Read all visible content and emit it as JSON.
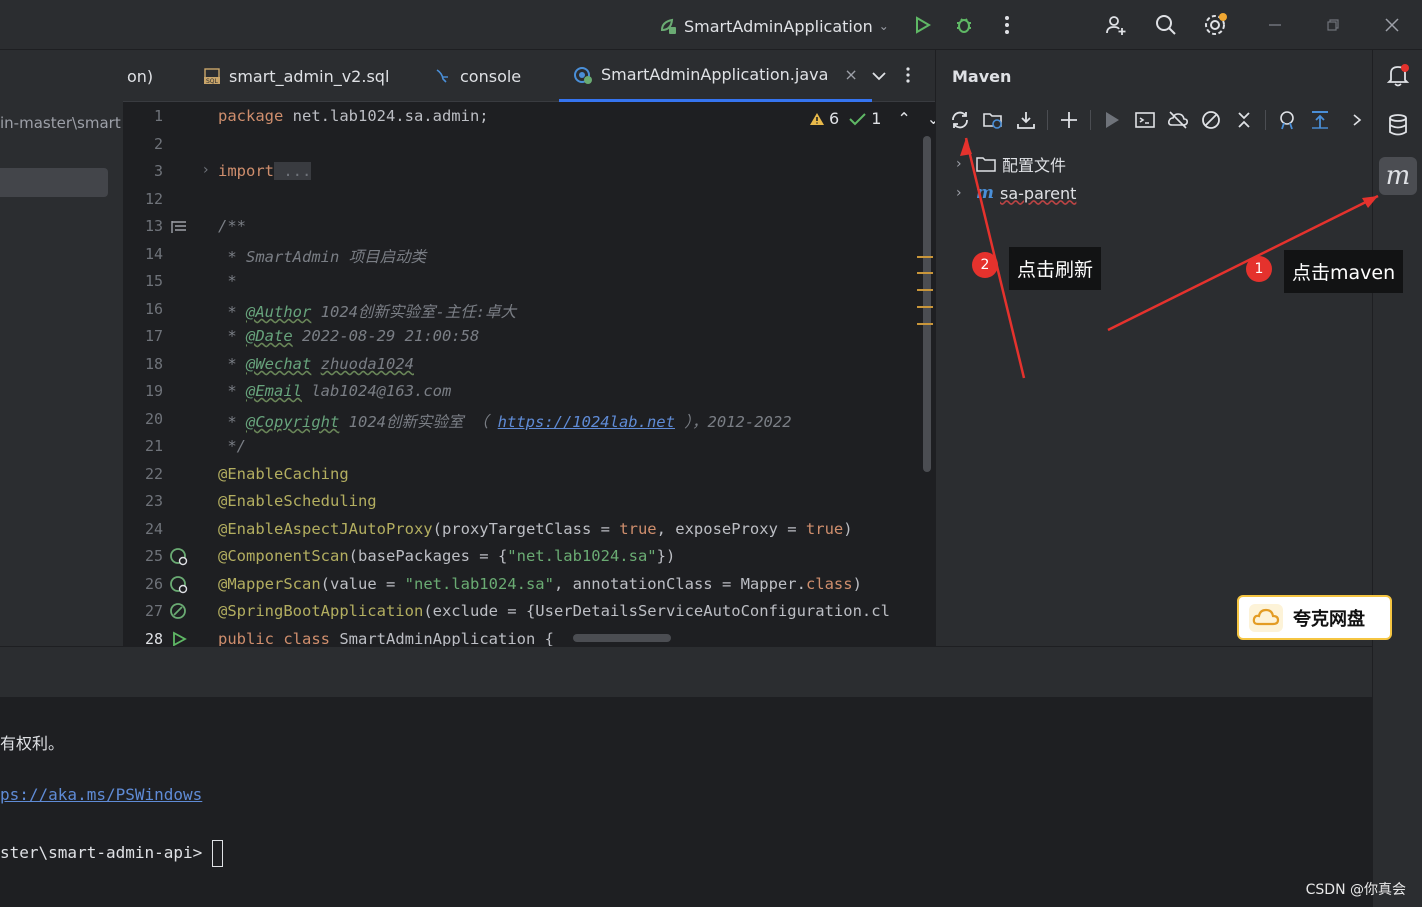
{
  "titlebar": {
    "run_config": "SmartAdminApplication",
    "icons": [
      "run-icon",
      "debug-icon",
      "more-icon",
      "add-user-icon",
      "search-icon",
      "settings-icon",
      "minimize-icon",
      "restore-icon",
      "close-icon"
    ]
  },
  "left_panel": {
    "path_text": "in-master\\smart"
  },
  "tabs": [
    {
      "label": "on)",
      "icon": ""
    },
    {
      "label": "smart_admin_v2.sql",
      "icon": "sql-file-icon"
    },
    {
      "label": "console",
      "icon": "console-icon"
    },
    {
      "label": "SmartAdminApplication.java",
      "icon": "java-class-icon",
      "active": true
    }
  ],
  "editor": {
    "inspection": {
      "warnings": "6",
      "ok": "1"
    },
    "gutter": [
      "1",
      "2",
      "3",
      "12",
      "13",
      "14",
      "15",
      "16",
      "17",
      "18",
      "19",
      "20",
      "21",
      "22",
      "23",
      "24",
      "25",
      "26",
      "27",
      "28"
    ],
    "lines": {
      "l1_kw": "package",
      "l1_rest": " net.lab1024.sa.admin;",
      "l3_kw": "import",
      "l3_fold": " ...",
      "l13": "/**",
      "l14": " * SmartAdmin 项目启动类",
      "l15": " *",
      "l16_tag": "@Author",
      "l16_rest": " 1024创新实验室-主任:卓大",
      "l17_tag": "@Date",
      "l17_rest": " 2022-08-29 21:00:58",
      "l18_tag": "@Wechat",
      "l18_rest": "zhuoda1024",
      "l19_tag": "@Email",
      "l19_rest": " lab1024@163.com",
      "l20_tag": "@Copyright",
      "l20_pre": " 1024创新实验室 （ ",
      "l20_link": "https://1024lab.net",
      "l20_post": " ），2012-2022",
      "l21": " */",
      "l22": "@EnableCaching",
      "l23": "@EnableScheduling",
      "l24_ann": "@EnableAspectJAutoProxy",
      "l24_a": "(proxyTargetClass = ",
      "l24_b": "true",
      "l24_c": ", exposeProxy = ",
      "l24_d": "true",
      "l24_e": ")",
      "l25_ann": "@ComponentScan",
      "l25_a": "(basePackages = {",
      "l25_str": "\"net.lab1024.sa\"",
      "l25_b": "})",
      "l26_ann": "@MapperScan",
      "l26_a": "(value = ",
      "l26_str": "\"net.lab1024.sa\"",
      "l26_b": ", annotationClass = Mapper.",
      "l26_kw": "class",
      "l26_c": ")",
      "l27_ann": "@SpringBootApplication",
      "l27_a": "(exclude = {UserDetailsServiceAutoConfiguration.cl",
      "l28_kw1": "public",
      "l28_kw2": "class",
      "l28_rest": " SmartAdminApplication {"
    }
  },
  "maven": {
    "title": "Maven",
    "tree": [
      {
        "label": "配置文件",
        "icon": "folder-icon"
      },
      {
        "label": "sa-parent",
        "icon": "maven-module-icon"
      }
    ]
  },
  "annotations": {
    "step1_number": "1",
    "step1_label": "点击maven",
    "step2_number": "2",
    "step2_label": "点击刷新"
  },
  "terminal": {
    "line1": "有权利。",
    "line2": "ps://aka.ms/PSWindows",
    "line3": "ster\\smart-admin-api> "
  },
  "quark": {
    "label": "夸克网盘"
  },
  "watermark": "CSDN @你真会"
}
